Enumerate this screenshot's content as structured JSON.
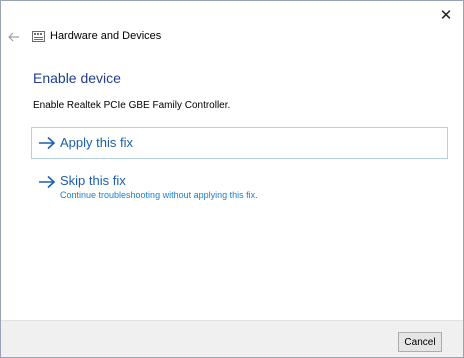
{
  "window": {
    "close_glyph": "✕"
  },
  "nav": {
    "title": "Hardware and Devices",
    "back_icon": "back-arrow-icon",
    "app_icon": "hardware-devices-icon"
  },
  "content": {
    "heading": "Enable device",
    "description": "Enable Realtek PCIe GBE Family Controller."
  },
  "options": [
    {
      "label": "Apply this fix",
      "subtext": ""
    },
    {
      "label": "Skip this fix",
      "subtext": "Continue troubleshooting without applying this fix."
    }
  ],
  "footer": {
    "cancel_label": "Cancel"
  },
  "colors": {
    "heading": "#1f3f8f",
    "link": "#1b5fae",
    "link_sub": "#1a7fce",
    "selected_border": "#b5cfe8",
    "footer_bg": "#f0f0f0"
  }
}
